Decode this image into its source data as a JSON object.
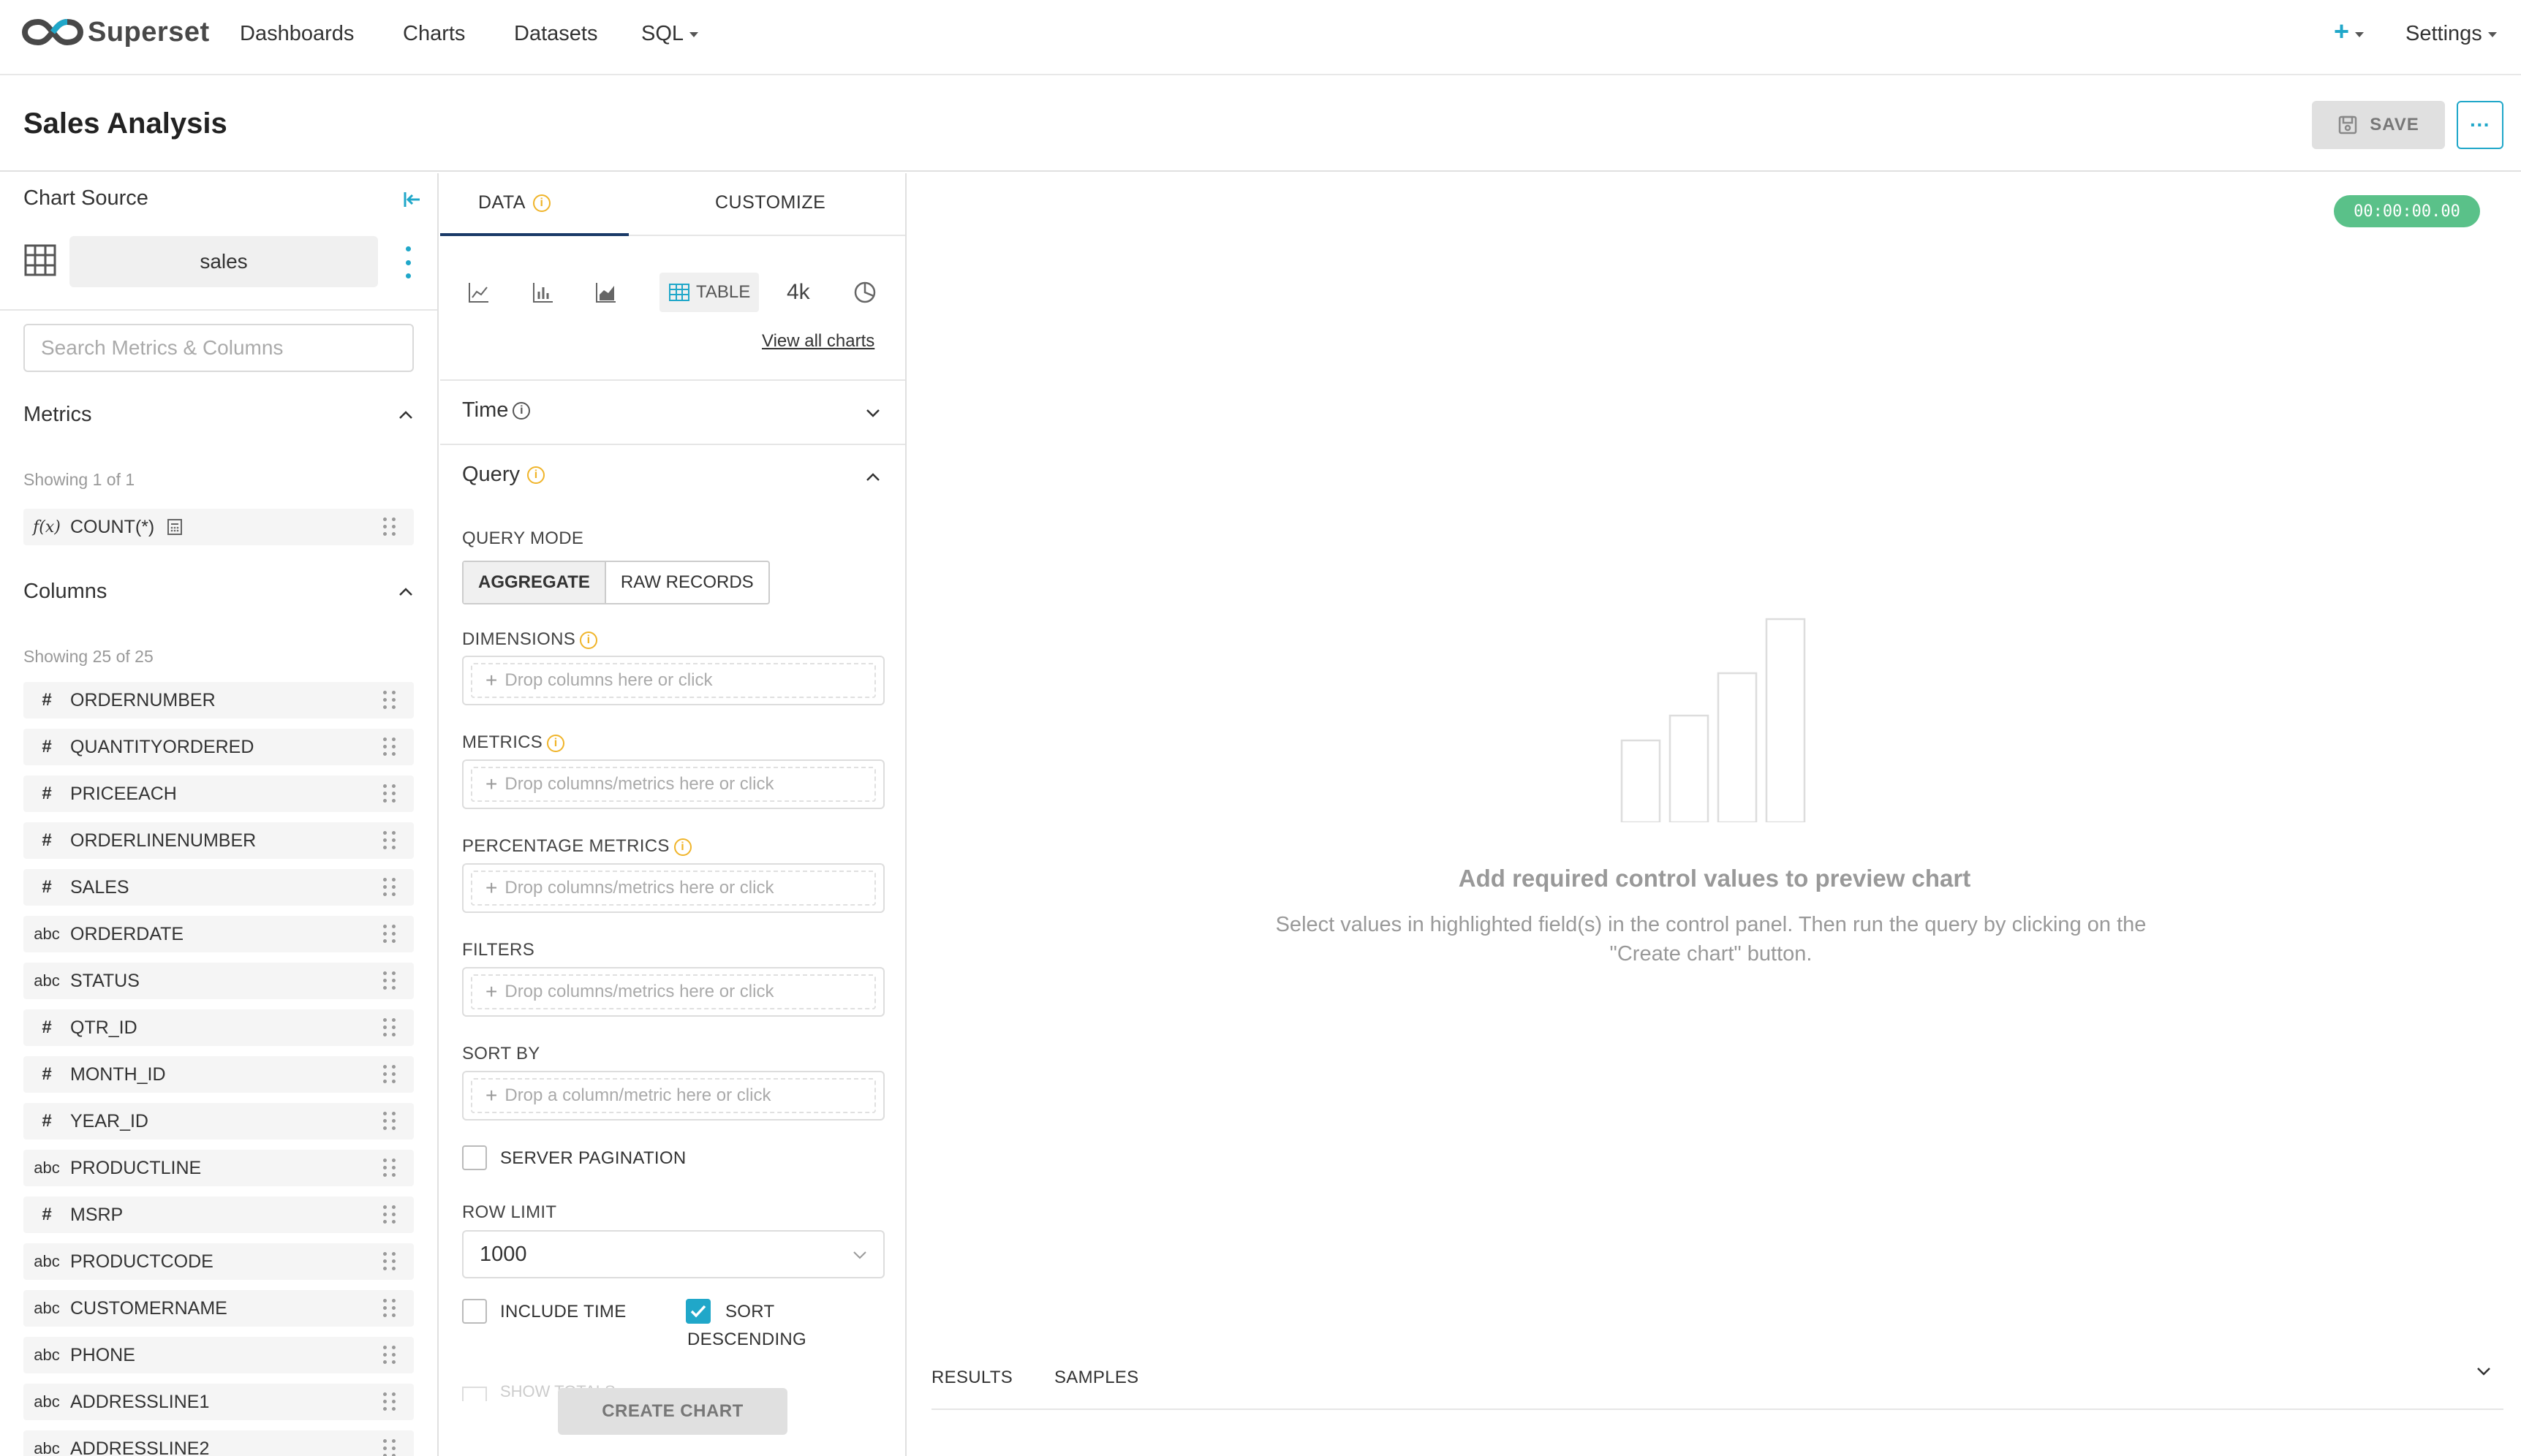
{
  "nav": {
    "brand": "Superset",
    "links": [
      "Dashboards",
      "Charts",
      "Datasets",
      "SQL"
    ],
    "plus": "+",
    "settings": "Settings"
  },
  "header": {
    "title": "Sales Analysis",
    "save_label": "SAVE",
    "more_label": "···"
  },
  "left": {
    "chart_source": "Chart Source",
    "dataset": "sales",
    "search_placeholder": "Search Metrics & Columns",
    "metrics_title": "Metrics",
    "metrics_showing": "Showing 1 of 1",
    "metrics": [
      {
        "type": "f(x)",
        "label": "COUNT(*)"
      }
    ],
    "columns_title": "Columns",
    "columns_showing": "Showing 25 of 25",
    "columns": [
      {
        "type": "#",
        "label": "ORDERNUMBER"
      },
      {
        "type": "#",
        "label": "QUANTITYORDERED"
      },
      {
        "type": "#",
        "label": "PRICEEACH"
      },
      {
        "type": "#",
        "label": "ORDERLINENUMBER"
      },
      {
        "type": "#",
        "label": "SALES"
      },
      {
        "type": "abc",
        "label": "ORDERDATE"
      },
      {
        "type": "abc",
        "label": "STATUS"
      },
      {
        "type": "#",
        "label": "QTR_ID"
      },
      {
        "type": "#",
        "label": "MONTH_ID"
      },
      {
        "type": "#",
        "label": "YEAR_ID"
      },
      {
        "type": "abc",
        "label": "PRODUCTLINE"
      },
      {
        "type": "#",
        "label": "MSRP"
      },
      {
        "type": "abc",
        "label": "PRODUCTCODE"
      },
      {
        "type": "abc",
        "label": "CUSTOMERNAME"
      },
      {
        "type": "abc",
        "label": "PHONE"
      },
      {
        "type": "abc",
        "label": "ADDRESSLINE1"
      },
      {
        "type": "abc",
        "label": "ADDRESSLINE2"
      }
    ]
  },
  "mid": {
    "tab_data": "DATA",
    "tab_customize": "CUSTOMIZE",
    "table_label": "TABLE",
    "big_number_label": "4k",
    "view_all": "View all charts",
    "time_title": "Time",
    "query_title": "Query",
    "query_mode_label": "QUERY MODE",
    "mode_aggregate": "AGGREGATE",
    "mode_raw": "RAW RECORDS",
    "dimensions_label": "DIMENSIONS",
    "dimensions_placeholder": "Drop columns here or click",
    "metrics_label": "METRICS",
    "metrics_placeholder": "Drop columns/metrics here or click",
    "percentage_label": "PERCENTAGE METRICS",
    "percentage_placeholder": "Drop columns/metrics here or click",
    "filters_label": "FILTERS",
    "filters_placeholder": "Drop columns/metrics here or click",
    "sortby_label": "SORT BY",
    "sortby_placeholder": "Drop a column/metric here or click",
    "server_pagination": "SERVER PAGINATION",
    "row_limit_label": "ROW LIMIT",
    "row_limit_value": "1000",
    "include_time": "INCLUDE TIME",
    "sort_desc_1": "SORT",
    "sort_desc_2": "DESCENDING",
    "faded_text": "SHOW TOTALS",
    "create_chart": "CREATE CHART",
    "plus": "+"
  },
  "right": {
    "timer": "00:00:00.00",
    "empty_title": "Add required control values to preview chart",
    "empty_desc": "Select values in highlighted field(s) in the control panel. Then run the query by clicking on the \"Create chart\" button.",
    "results_tab": "RESULTS",
    "samples_tab": "SAMPLES"
  },
  "colors": {
    "accent": "#20a7c9",
    "timer_bg": "#5ac189",
    "tab_underline": "#1a3a68",
    "info_yellow": "#f0b429"
  }
}
